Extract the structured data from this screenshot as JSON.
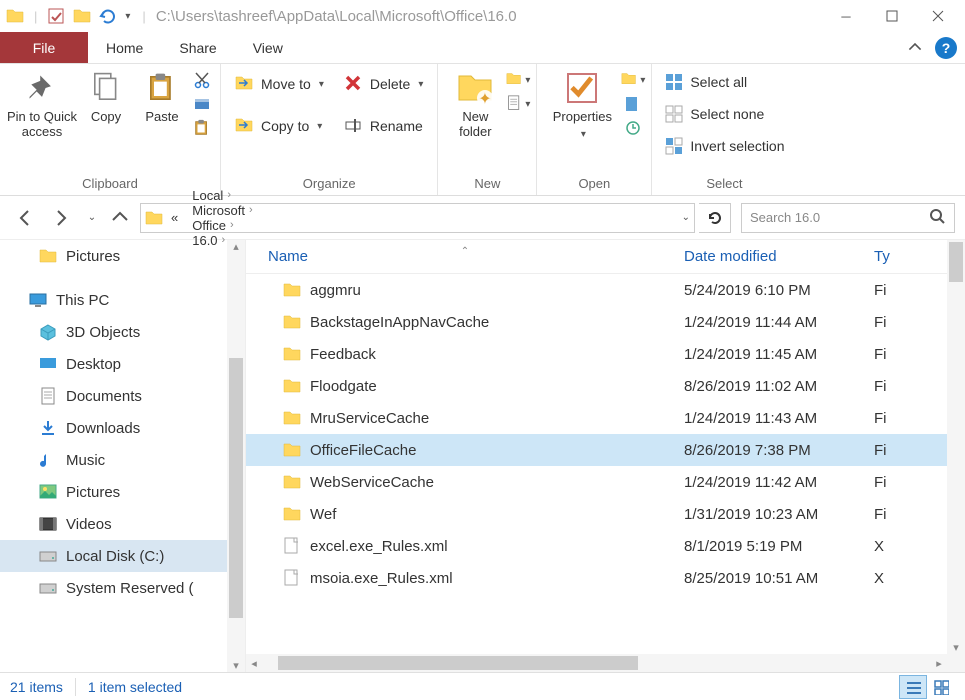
{
  "title_path": "C:\\Users\\tashreef\\AppData\\Local\\Microsoft\\Office\\16.0",
  "tabs": {
    "file": "File",
    "home": "Home",
    "share": "Share",
    "view": "View"
  },
  "ribbon": {
    "clipboard": {
      "pin": "Pin to Quick access",
      "copy": "Copy",
      "paste": "Paste",
      "label": "Clipboard"
    },
    "organize": {
      "moveto": "Move to",
      "copyto": "Copy to",
      "delete": "Delete",
      "rename": "Rename",
      "label": "Organize"
    },
    "new": {
      "newfolder": "New folder",
      "label": "New"
    },
    "open": {
      "properties": "Properties",
      "label": "Open"
    },
    "select": {
      "selectall": "Select all",
      "selectnone": "Select none",
      "invert": "Invert selection",
      "label": "Select"
    }
  },
  "breadcrumbs": [
    "Local",
    "Microsoft",
    "Office",
    "16.0"
  ],
  "search_placeholder": "Search 16.0",
  "navpane": {
    "pictures": "Pictures",
    "thispc": "This PC",
    "items": [
      "3D Objects",
      "Desktop",
      "Documents",
      "Downloads",
      "Music",
      "Pictures",
      "Videos",
      "Local Disk (C:)",
      "System Reserved ("
    ]
  },
  "columns": {
    "name": "Name",
    "date": "Date modified",
    "type": "Ty"
  },
  "files": [
    {
      "name": "aggmru",
      "date": "5/24/2019 6:10 PM",
      "type": "Fi",
      "kind": "folder"
    },
    {
      "name": "BackstageInAppNavCache",
      "date": "1/24/2019 11:44 AM",
      "type": "Fi",
      "kind": "folder"
    },
    {
      "name": "Feedback",
      "date": "1/24/2019 11:45 AM",
      "type": "Fi",
      "kind": "folder"
    },
    {
      "name": "Floodgate",
      "date": "8/26/2019 11:02 AM",
      "type": "Fi",
      "kind": "folder"
    },
    {
      "name": "MruServiceCache",
      "date": "1/24/2019 11:43 AM",
      "type": "Fi",
      "kind": "folder"
    },
    {
      "name": "OfficeFileCache",
      "date": "8/26/2019 7:38 PM",
      "type": "Fi",
      "kind": "folder",
      "selected": true
    },
    {
      "name": "WebServiceCache",
      "date": "1/24/2019 11:42 AM",
      "type": "Fi",
      "kind": "folder"
    },
    {
      "name": "Wef",
      "date": "1/31/2019 10:23 AM",
      "type": "Fi",
      "kind": "folder"
    },
    {
      "name": "excel.exe_Rules.xml",
      "date": "8/1/2019 5:19 PM",
      "type": "X",
      "kind": "file"
    },
    {
      "name": "msoia.exe_Rules.xml",
      "date": "8/25/2019 10:51 AM",
      "type": "X",
      "kind": "file"
    }
  ],
  "status": {
    "items": "21 items",
    "selected": "1 item selected"
  }
}
